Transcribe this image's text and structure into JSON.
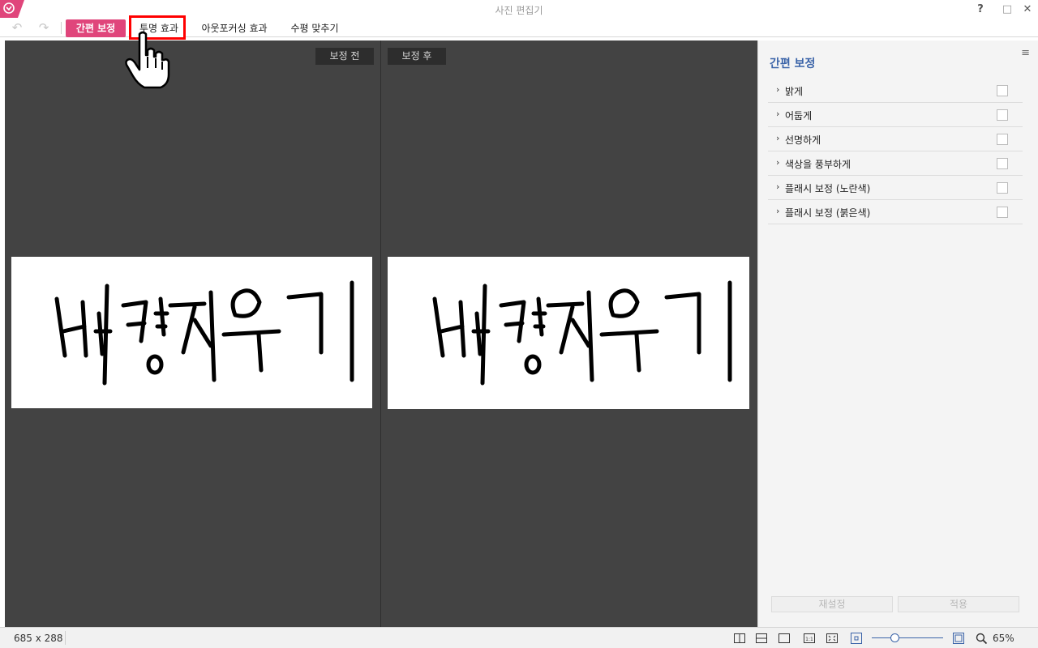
{
  "window": {
    "title": "사진 편집기",
    "help": "?",
    "maximize": "□",
    "close": "✕"
  },
  "toolbar": {
    "undo_icon": "↶",
    "redo_icon": "↷"
  },
  "tabs": [
    {
      "label": "간편 보정",
      "active": true
    },
    {
      "label": "투명 효과",
      "active": false,
      "highlighted": true
    },
    {
      "label": "아웃포커싱 효과",
      "active": false
    },
    {
      "label": "수평 맞추기",
      "active": false
    }
  ],
  "canvas": {
    "before_label": "보정 전",
    "after_label": "보정 후",
    "image_text": "배경지우기"
  },
  "panel": {
    "menu_icon": "≡",
    "title": "간편 보정",
    "items": [
      {
        "label": "밝게"
      },
      {
        "label": "어둡게"
      },
      {
        "label": "선명하게"
      },
      {
        "label": "색상을 풍부하게"
      },
      {
        "label": "플래시 보정 (노란색)"
      },
      {
        "label": "플래시 보정 (붉은색)"
      }
    ],
    "reset_label": "재설정",
    "apply_label": "적용"
  },
  "status": {
    "dimensions": "685 x 288",
    "zoom": "65%"
  },
  "colors": {
    "accent": "#e0457b",
    "panel_title": "#3a63a8",
    "canvas_bg": "#434343",
    "highlight": "#ff0000"
  },
  "icons": [
    "app-logo-icon",
    "undo-icon",
    "redo-icon",
    "hand-pointer-cursor",
    "split-vertical-icon",
    "split-horizontal-icon",
    "single-view-icon",
    "actual-size-icon",
    "fit-screen-icon",
    "zoom-out-icon",
    "zoom-in-icon",
    "magnifier-icon",
    "menu-icon"
  ]
}
